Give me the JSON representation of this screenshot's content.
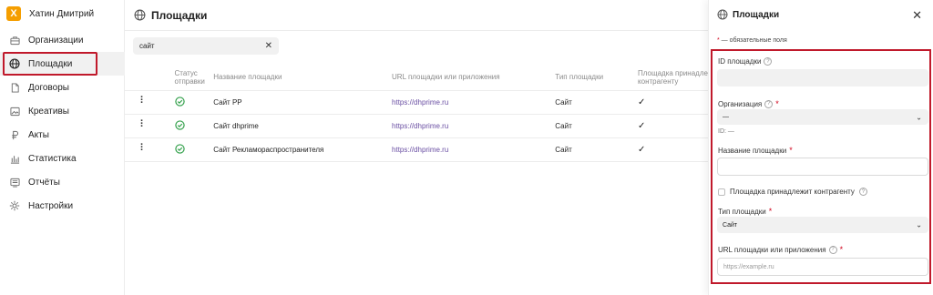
{
  "user": {
    "avatar_letter": "Х",
    "name": "Хатин Дмитрий"
  },
  "sidebar": {
    "items": [
      {
        "label": "Организации",
        "icon": "briefcase-icon"
      },
      {
        "label": "Площадки",
        "icon": "globe-icon",
        "active": true
      },
      {
        "label": "Договоры",
        "icon": "document-icon"
      },
      {
        "label": "Креативы",
        "icon": "image-icon"
      },
      {
        "label": "Акты",
        "icon": "ruble-icon"
      },
      {
        "label": "Статистика",
        "icon": "bar-chart-icon"
      },
      {
        "label": "Отчёты",
        "icon": "report-icon"
      },
      {
        "label": "Настройки",
        "icon": "gear-icon"
      }
    ]
  },
  "main": {
    "title": "Площадки",
    "filter": {
      "value": "сайт"
    },
    "table": {
      "headers": {
        "status_line1": "Статус",
        "status_line2": "отправки",
        "name": "Название площадки",
        "url": "URL площадки или приложения",
        "type": "Тип площадки",
        "owner_line1": "Площадка принадле",
        "owner_line2": "контрагенту"
      },
      "rows": [
        {
          "name": "Сайт РР",
          "url": "https://dhprime.ru",
          "type": "Сайт"
        },
        {
          "name": "Сайт dhprime",
          "url": "https://dhprime.ru",
          "type": "Сайт"
        },
        {
          "name": "Сайт Рекламораспространителя",
          "url": "https://dhprime.ru",
          "type": "Сайт"
        }
      ],
      "check_mark": "✓"
    }
  },
  "panel": {
    "title": "Площадки",
    "required_note_star": "*",
    "required_note": " — обязательные поля",
    "fields": {
      "id_label": "ID площадки",
      "org_label": "Организация",
      "org_value": "—",
      "org_id": "ID: —",
      "name_label": "Название площадки",
      "owner_checkbox": "Площадка принадлежит контрагенту",
      "type_label": "Тип площадки",
      "type_value": "Сайт",
      "url_label": "URL площадки или приложения",
      "url_placeholder": "https://example.ru"
    }
  },
  "colors": {
    "accent_highlight": "#c0192b",
    "status_ok": "#2e9e47",
    "link": "#6a4fa3",
    "logo": "#f59e00"
  }
}
